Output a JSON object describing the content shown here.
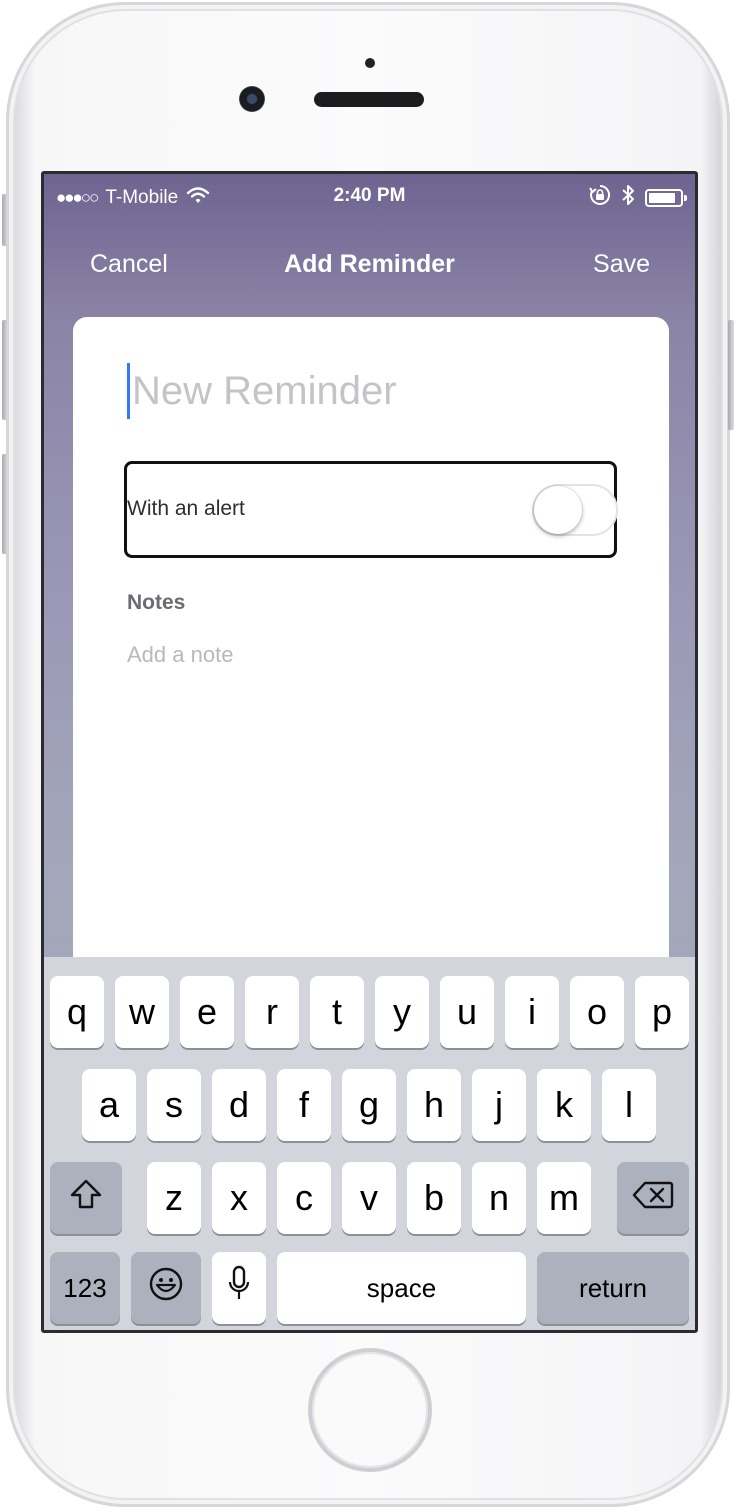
{
  "status_bar": {
    "signal": "●●●○○",
    "carrier": "T-Mobile",
    "time": "2:40 PM"
  },
  "nav": {
    "cancel_label": "Cancel",
    "title": "Add Reminder",
    "save_label": "Save"
  },
  "form": {
    "title_placeholder": "New Reminder",
    "title_value": "",
    "alert_label": "With an alert",
    "alert_enabled": false,
    "notes_heading": "Notes",
    "notes_placeholder": "Add a note",
    "notes_value": ""
  },
  "keyboard": {
    "row1": [
      "q",
      "w",
      "e",
      "r",
      "t",
      "y",
      "u",
      "i",
      "o",
      "p"
    ],
    "row2": [
      "a",
      "s",
      "d",
      "f",
      "g",
      "h",
      "j",
      "k",
      "l"
    ],
    "row3": [
      "z",
      "x",
      "c",
      "v",
      "b",
      "n",
      "m"
    ],
    "numbers_label": "123",
    "space_label": "space",
    "return_label": "return"
  },
  "icons": {
    "wifi": "wifi-icon",
    "rotation_lock": "rotation-lock-icon",
    "bluetooth": "bluetooth-icon",
    "battery": "battery-icon",
    "shift": "shift-icon",
    "delete": "delete-icon",
    "emoji": "emoji-icon",
    "microphone": "microphone-icon"
  },
  "colors": {
    "cursor": "#3578f2",
    "gradient_top": "#6d6490",
    "keyboard_bg": "#d2d5db"
  }
}
